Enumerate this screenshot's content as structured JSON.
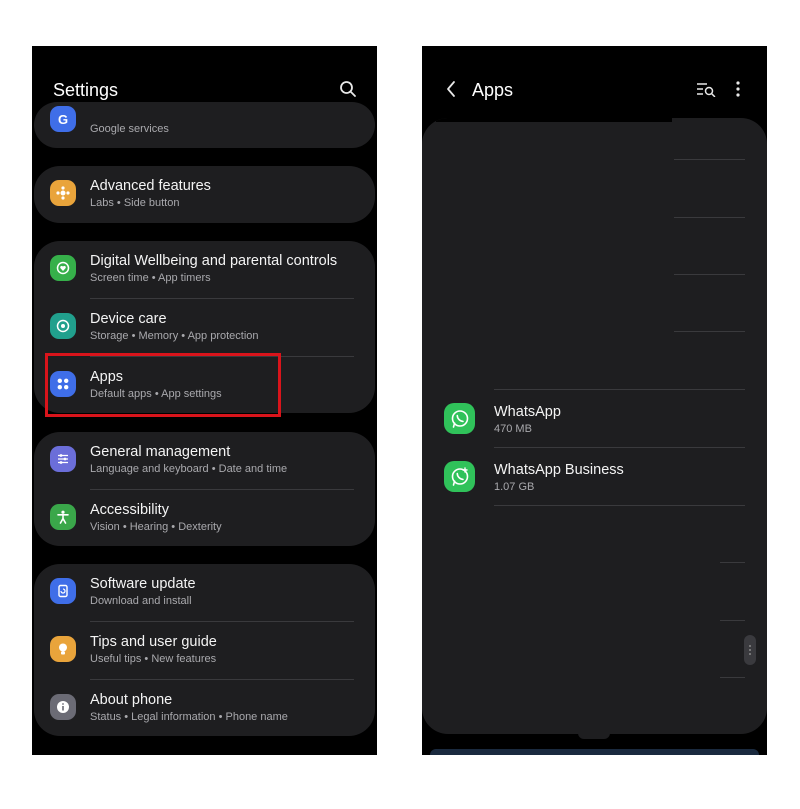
{
  "left": {
    "title": "Settings",
    "google": {
      "subtitle": "Google services"
    },
    "items": [
      {
        "title": "Advanced features",
        "subtitle": "Labs  •  Side button",
        "icon": "puzzle-icon",
        "color": "#e9a43b"
      },
      {
        "title": "Digital Wellbeing and parental controls",
        "subtitle": "Screen time  •  App timers",
        "icon": "wellbeing-icon",
        "color": "#36b04a"
      },
      {
        "title": "Device care",
        "subtitle": "Storage  •  Memory  •  App protection",
        "icon": "device-care-icon",
        "color": "#21a08d"
      },
      {
        "title": "Apps",
        "subtitle": "Default apps  •  App settings",
        "icon": "apps-grid-icon",
        "color": "#3f6ee8"
      },
      {
        "title": "General management",
        "subtitle": "Language and keyboard  •  Date and time",
        "icon": "sliders-icon",
        "color": "#6b6ed9"
      },
      {
        "title": "Accessibility",
        "subtitle": "Vision  •  Hearing  •  Dexterity",
        "icon": "accessibility-icon",
        "color": "#3aa74a"
      },
      {
        "title": "Software update",
        "subtitle": "Download and install",
        "icon": "software-update-icon",
        "color": "#3f6ee8"
      },
      {
        "title": "Tips and user guide",
        "subtitle": "Useful tips  •  New features",
        "icon": "lightbulb-icon",
        "color": "#e9a43b"
      },
      {
        "title": "About phone",
        "subtitle": "Status  •  Legal information  •  Phone name",
        "icon": "info-icon",
        "color": "#6b6b75"
      }
    ]
  },
  "right": {
    "title": "Apps",
    "apps": [
      {
        "name": "WhatsApp",
        "size": "470 MB",
        "icon": "whatsapp-icon"
      },
      {
        "name": "WhatsApp Business",
        "size": "1.07 GB",
        "icon": "whatsapp-business-icon"
      }
    ]
  },
  "colors": {
    "highlight": "#d9141b",
    "card": "#1e1e20",
    "background": "#000000",
    "whatsapp": "#30c25a"
  }
}
